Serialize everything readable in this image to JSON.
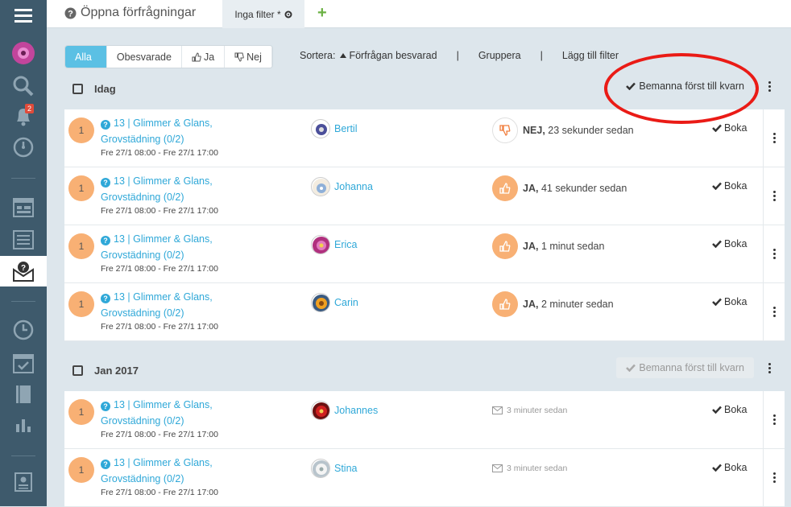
{
  "header": {
    "title": "Öppna förfrågningar",
    "tab_label": "Inga filter *"
  },
  "sidebar": {
    "notification_count": "2"
  },
  "filters": {
    "items": [
      "Alla",
      "Obesvarade",
      "Ja",
      "Nej"
    ],
    "active": "Alla"
  },
  "toolbar": {
    "sort_label": "Sortera:",
    "sort_value": "Förfrågan besvarad",
    "group_label": "Gruppera",
    "add_filter_label": "Lägg till filter",
    "separator": "|"
  },
  "groups": [
    {
      "label": "Idag",
      "action_label": "Bemanna först till kvarn",
      "action_enabled": true,
      "rows": [
        {
          "num": "1",
          "req_line1": "13 | Glimmer & Glans,",
          "req_line2": "Grovstädning (0/2)",
          "time": "Fre 27/1 08:00 - Fre 27/1 17:00",
          "person": "Bertil",
          "answer": "NEJ,",
          "answer_time": "23 sekunder sedan",
          "book": "Boka"
        },
        {
          "num": "1",
          "req_line1": "13 | Glimmer & Glans,",
          "req_line2": "Grovstädning (0/2)",
          "time": "Fre 27/1 08:00 - Fre 27/1 17:00",
          "person": "Johanna",
          "answer": "JA,",
          "answer_time": "41 sekunder sedan",
          "book": "Boka"
        },
        {
          "num": "1",
          "req_line1": "13 | Glimmer & Glans,",
          "req_line2": "Grovstädning (0/2)",
          "time": "Fre 27/1 08:00 - Fre 27/1 17:00",
          "person": "Erica",
          "answer": "JA,",
          "answer_time": "1 minut sedan",
          "book": "Boka"
        },
        {
          "num": "1",
          "req_line1": "13 | Glimmer & Glans,",
          "req_line2": "Grovstädning (0/2)",
          "time": "Fre 27/1 08:00 - Fre 27/1 17:00",
          "person": "Carin",
          "answer": "JA,",
          "answer_time": "2 minuter sedan",
          "book": "Boka"
        }
      ]
    },
    {
      "label": "Jan 2017",
      "action_label": "Bemanna först till kvarn",
      "action_enabled": false,
      "rows": [
        {
          "num": "1",
          "req_line1": "13 | Glimmer & Glans,",
          "req_line2": "Grovstädning (0/2)",
          "time": "Fre 27/1 08:00 - Fre 27/1 17:00",
          "person": "Johannes",
          "sent_time": "3 minuter sedan",
          "book": "Boka"
        },
        {
          "num": "1",
          "req_line1": "13 | Glimmer & Glans,",
          "req_line2": "Grovstädning (0/2)",
          "time": "Fre 27/1 08:00 - Fre 27/1 17:00",
          "person": "Stina",
          "sent_time": "3 minuter sedan",
          "book": "Boka"
        }
      ]
    }
  ],
  "colors": {
    "accent": "#5bc0e4",
    "link": "#2fa8d8",
    "badge_orange": "#f8b074",
    "callout": "#ea1b16",
    "sidebar": "#3e5a6c"
  }
}
